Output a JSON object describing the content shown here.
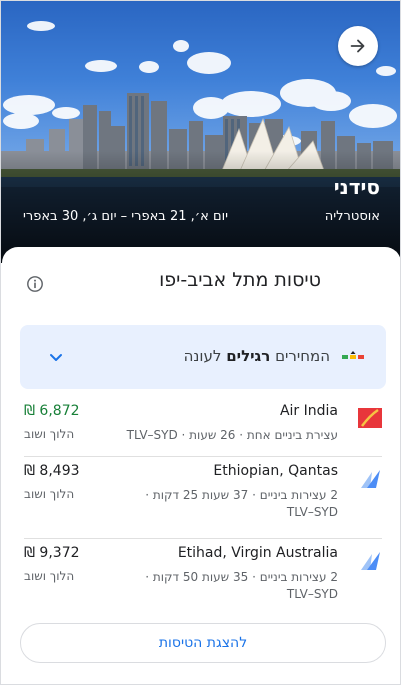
{
  "destination": {
    "city": "סידני",
    "country": "אוסטרליה",
    "dates": "יום א׳, 21 באפרי – יום ג׳, 30 באפרי"
  },
  "card": {
    "title": "טיסות מתל אביב-יפו",
    "price_level": {
      "prefix": "המחירים",
      "level": "רגילים",
      "suffix": "לעונה"
    },
    "flights": [
      {
        "airline": "Air India",
        "details": "עצירת ביניים אחת · 26 שעות · TLV–SYD",
        "price": "₪ 6,872",
        "trip_type": "הלוך ושוב",
        "price_color": "#188038"
      },
      {
        "airline": "Ethiopian, Qantas",
        "details": "2 עצירות ביניים · 37 שעות 25 דקות · TLV–SYD",
        "price": "₪ 8,493",
        "trip_type": "הלוך ושוב",
        "price_color": "#202124"
      },
      {
        "airline": "Etihad, Virgin Australia",
        "details": "2 עצירות ביניים · 35 שעות 50 דקות · TLV–SYD",
        "price": "₪ 9,372",
        "trip_type": "הלוך ושוב",
        "price_color": "#202124"
      }
    ],
    "show_flights_label": "להצגת הטיסות"
  },
  "icons": {
    "forward": "arrow-right-icon",
    "info": "info-icon",
    "price_level": "price-level-icon",
    "expand": "chevron-down-icon",
    "airline_1": "air-india-logo",
    "airline_multi": "multi-airline-icon"
  },
  "colors": {
    "accent": "#1a73e8",
    "price_box_bg": "#e8f0fe",
    "good_price": "#188038"
  }
}
